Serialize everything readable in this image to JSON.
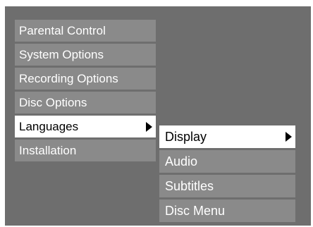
{
  "main_menu": {
    "items": [
      {
        "label": "Parental Control"
      },
      {
        "label": "System Options"
      },
      {
        "label": "Recording Options"
      },
      {
        "label": "Disc Options"
      },
      {
        "label": "Languages",
        "selected": true,
        "has_submenu": true
      },
      {
        "label": "Installation"
      }
    ]
  },
  "sub_menu": {
    "items": [
      {
        "label": "Display",
        "selected": true,
        "has_submenu": true
      },
      {
        "label": "Audio"
      },
      {
        "label": "Subtitles"
      },
      {
        "label": "Disc Menu"
      }
    ]
  },
  "colors": {
    "screen_background": "#6e6e6e",
    "item_background": "#8a8a8a",
    "selected_background": "#ffffff",
    "item_text": "#ffffff",
    "selected_text": "#000000"
  },
  "icons": {
    "submenu_indicator": "triangle-right-icon"
  }
}
